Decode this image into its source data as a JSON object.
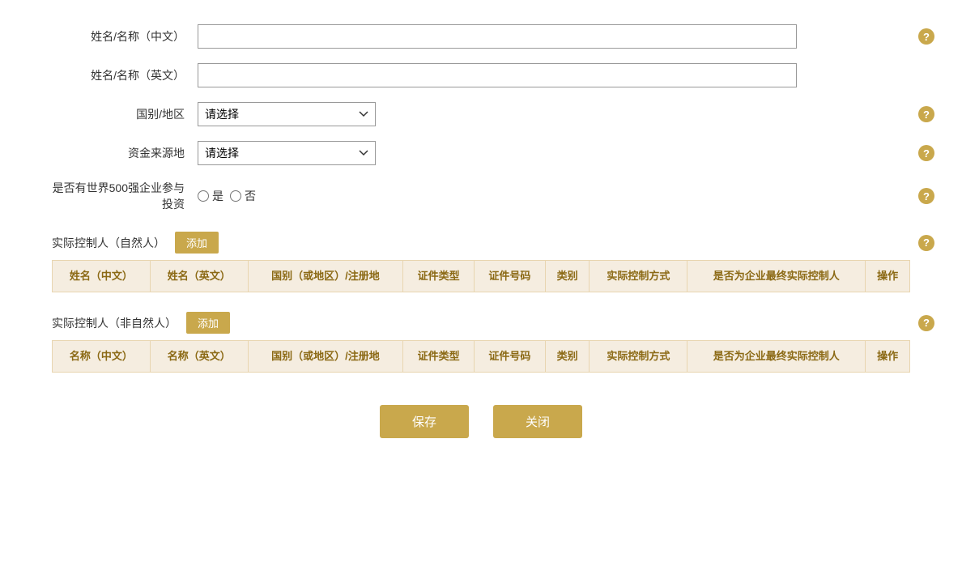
{
  "form": {
    "name_zh_label": "姓名/名称（中文）",
    "name_en_label": "姓名/名称（英文）",
    "country_label": "国别/地区",
    "funding_source_label": "资金来源地",
    "fortune500_label": "是否有世界500强企业参与投资",
    "fortune500_yes": "是",
    "fortune500_no": "否",
    "country_placeholder": "请选择",
    "funding_placeholder": "请选择",
    "name_zh_placeholder": "",
    "name_en_placeholder": ""
  },
  "section_natural": {
    "title": "实际控制人（自然人）",
    "add_label": "添加",
    "columns": [
      "姓名（中文）",
      "姓名（英文）",
      "国别（或地区）/注册地",
      "证件类型",
      "证件号码",
      "类别",
      "实际控制方式",
      "是否为企业最终实际控制人",
      "操作"
    ]
  },
  "section_non_natural": {
    "title": "实际控制人（非自然人）",
    "add_label": "添加",
    "columns": [
      "名称（中文）",
      "名称（英文）",
      "国别（或地区）/注册地",
      "证件类型",
      "证件号码",
      "类别",
      "实际控制方式",
      "是否为企业最终实际控制人",
      "操作"
    ]
  },
  "buttons": {
    "save": "保存",
    "close": "关闭"
  },
  "help_icon": "?",
  "colors": {
    "gold": "#c9a84c",
    "table_header_bg": "#f5ede0",
    "table_header_text": "#8b6914"
  }
}
